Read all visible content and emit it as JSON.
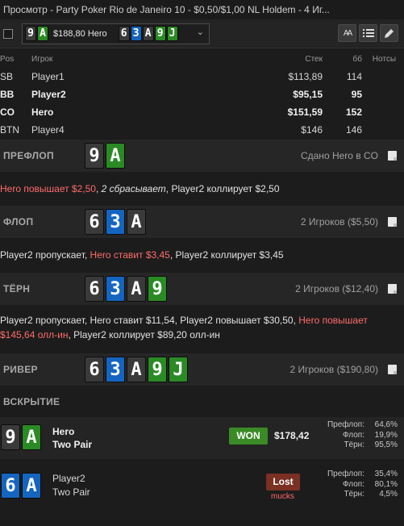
{
  "window": {
    "title": "Просмотр - Party Poker Rio de Janeiro 10 - $0,50/$1,00 NL Holdem - 4 Иг..."
  },
  "toolbar": {
    "hand_cards": [
      {
        "rank": "9",
        "suit": "spade"
      },
      {
        "rank": "A",
        "suit": "club"
      }
    ],
    "hand_amount": "$188,80 Hero",
    "board_cards": [
      {
        "rank": "6",
        "suit": "spade"
      },
      {
        "rank": "3",
        "suit": "diamond"
      },
      {
        "rank": "A",
        "suit": "spade"
      },
      {
        "rank": "9",
        "suit": "club"
      },
      {
        "rank": "J",
        "suit": "club"
      }
    ],
    "font_button": "AA",
    "list_button": "list-icon",
    "edit_button": "pencil-icon"
  },
  "table": {
    "headers": {
      "pos": "Pos",
      "name": "Игрок",
      "stack": "Стек",
      "bb": "бб",
      "notes": "Нотсы"
    },
    "rows": [
      {
        "pos": "SB",
        "name": "Player1",
        "stack": "$113,89",
        "bb": "114",
        "bold": false
      },
      {
        "pos": "BB",
        "name": "Player2",
        "stack": "$95,15",
        "bb": "95",
        "bold": true
      },
      {
        "pos": "CO",
        "name": "Hero",
        "stack": "$151,59",
        "bb": "152",
        "bold": true
      },
      {
        "pos": "BTN",
        "name": "Player4",
        "stack": "$146",
        "bb": "146",
        "bold": false
      }
    ]
  },
  "preflop": {
    "label": "ПРЕФЛОП",
    "info": "Сдано Hero в CO",
    "cards": [
      {
        "rank": "9",
        "suit": "spade"
      },
      {
        "rank": "A",
        "suit": "club"
      }
    ],
    "a1": "Hero повышает $2,50",
    "a2": ", ",
    "a3": "2 сбрасывает",
    "a4": ", Player2 коллирует $2,50"
  },
  "flop": {
    "label": "ФЛОП",
    "info": "2 Игроков ($5,50)",
    "cards": [
      {
        "rank": "6",
        "suit": "spade"
      },
      {
        "rank": "3",
        "suit": "diamond"
      },
      {
        "rank": "A",
        "suit": "spade"
      }
    ],
    "a1": "Player2 пропускает, ",
    "a2": "Hero ставит $3,45",
    "a3": ", Player2 коллирует $3,45"
  },
  "turn": {
    "label": "ТЁРН",
    "info": "2 Игроков ($12,40)",
    "cards": [
      {
        "rank": "6",
        "suit": "spade"
      },
      {
        "rank": "3",
        "suit": "diamond"
      },
      {
        "rank": "A",
        "suit": "spade"
      },
      {
        "rank": "9",
        "suit": "club"
      }
    ],
    "a1": "Player2 пропускает, Hero ставит $11,54, Player2 повышает $30,50, ",
    "a2": "Hero повышает $145,64 олл-ин",
    "a3": ", Player2 коллирует $89,20 олл-ин"
  },
  "river": {
    "label": "РИВЕР",
    "info": "2 Игроков ($190,80)",
    "cards": [
      {
        "rank": "6",
        "suit": "spade"
      },
      {
        "rank": "3",
        "suit": "diamond"
      },
      {
        "rank": "A",
        "suit": "spade"
      },
      {
        "rank": "9",
        "suit": "club"
      },
      {
        "rank": "J",
        "suit": "club"
      }
    ]
  },
  "showdown": {
    "label": "ВСКРЫТИЕ",
    "players": [
      {
        "name": "Hero",
        "hand": "Two Pair",
        "cards": [
          {
            "rank": "9",
            "suit": "spade"
          },
          {
            "rank": "A",
            "suit": "club"
          }
        ],
        "result": "WON",
        "amount": "$178,42",
        "equity": [
          {
            "label": "Префлоп:",
            "value": "64,6%"
          },
          {
            "label": "Флоп:",
            "value": "19,9%"
          },
          {
            "label": "Тёрн:",
            "value": "95,5%"
          }
        ]
      },
      {
        "name": "Player2",
        "hand": "Two Pair",
        "cards": [
          {
            "rank": "6",
            "suit": "diamond"
          },
          {
            "rank": "A",
            "suit": "diamond"
          }
        ],
        "result": "Lost",
        "sub": "mucks",
        "equity": [
          {
            "label": "Префлоп:",
            "value": "35,4%"
          },
          {
            "label": "Флоп:",
            "value": "80,1%"
          },
          {
            "label": "Тёрн:",
            "value": "4,5%"
          }
        ]
      }
    ]
  },
  "colors": {
    "spade": "#3a3a3a",
    "club": "#2a8a24",
    "diamond": "#1565c0",
    "hero_action": "#ff6b6b",
    "won": "#3a8b25",
    "lost": "#7a3023"
  }
}
